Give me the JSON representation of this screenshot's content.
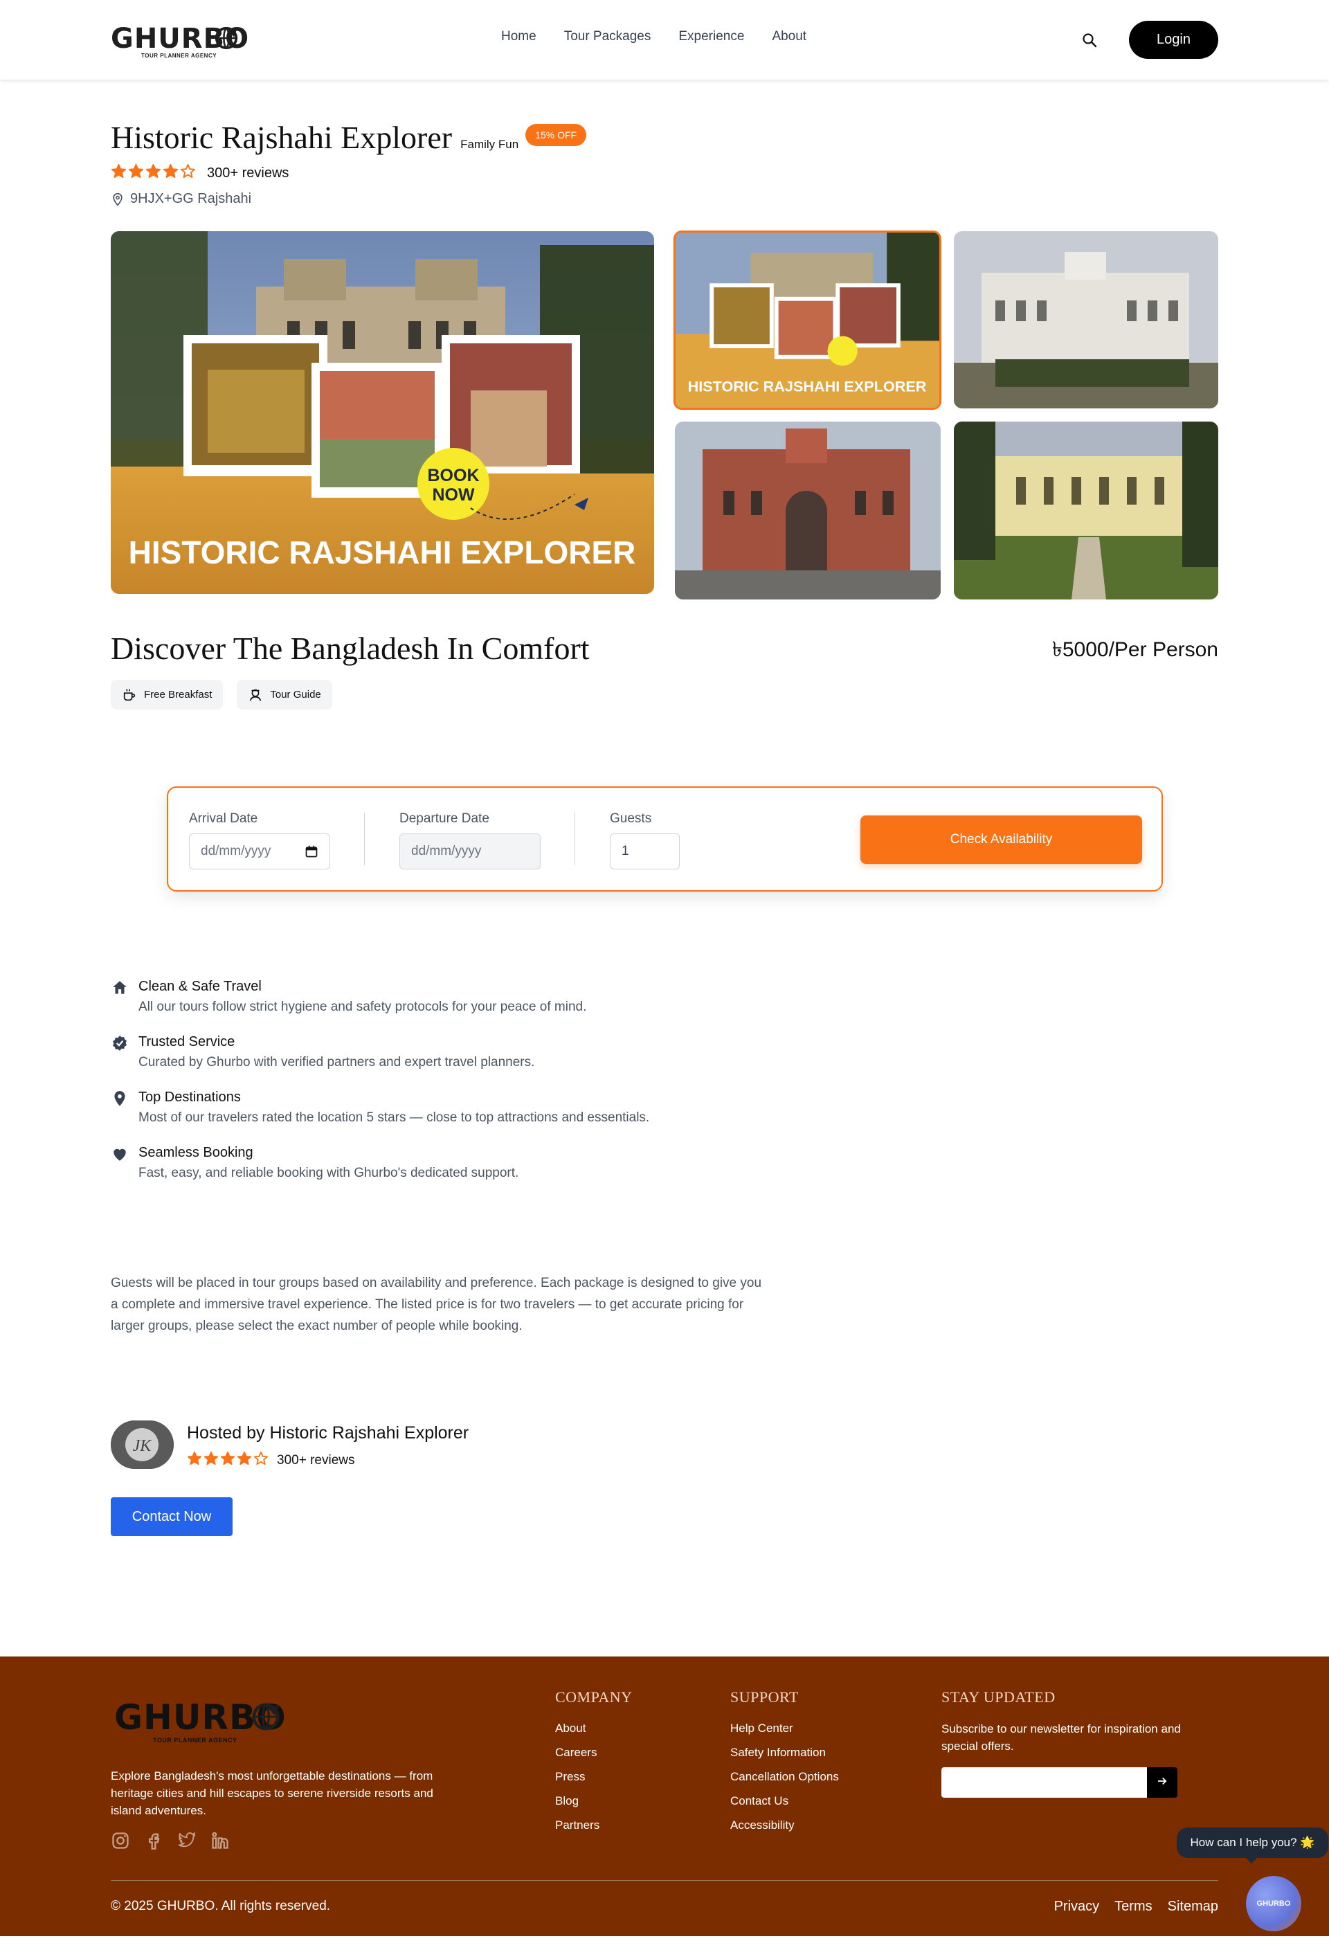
{
  "brand": {
    "name": "GHURBO",
    "tagline": "TOUR PLANNER AGENCY"
  },
  "nav": {
    "links": [
      "Home",
      "Tour Packages",
      "Experience",
      "About"
    ],
    "login_label": "Login"
  },
  "tour": {
    "title": "Historic Rajshahi Explorer",
    "category": "Family Fun",
    "discount": "15% OFF",
    "rating": 4,
    "rating_max": 5,
    "reviews": "300+ reviews",
    "location": "9HJX+GG Rajshahi",
    "poster_text": "HISTORIC RAJSHAHI EXPLORER",
    "poster_badge": [
      "BOOK",
      "NOW"
    ]
  },
  "discover": {
    "title": "Discover The Bangladesh In Comfort",
    "price": "৳5000/Per Person",
    "amenities": [
      "Free Breakfast",
      "Tour Guide"
    ]
  },
  "booking": {
    "arrival_label": "Arrival Date",
    "arrival_placeholder": "dd/mm/yyyy",
    "departure_label": "Departure Date",
    "departure_placeholder": "dd/mm/yyyy",
    "guests_label": "Guests",
    "guests_value": "1",
    "submit_label": "Check Availability"
  },
  "features": [
    {
      "icon": "home-icon",
      "title": "Clean & Safe Travel",
      "desc": "All our tours follow strict hygiene and safety protocols for your peace of mind."
    },
    {
      "icon": "verified-badge-icon",
      "title": "Trusted Service",
      "desc": "Curated by Ghurbo with verified partners and expert travel planners."
    },
    {
      "icon": "map-pin-icon",
      "title": "Top Destinations",
      "desc": "Most of our travelers rated the location 5 stars — close to top attractions and essentials."
    },
    {
      "icon": "heart-icon",
      "title": "Seamless Booking",
      "desc": "Fast, easy, and reliable booking with Ghurbo's dedicated support."
    }
  ],
  "description": "Guests will be placed in tour groups based on availability and preference. Each package is designed to give you a complete and immersive travel experience. The listed price is for two travelers — to get accurate pricing for larger groups, please select the exact number of people while booking.",
  "host": {
    "name": "Hosted by Historic Rajshahi Explorer",
    "rating": 4,
    "reviews": "300+ reviews",
    "contact_label": "Contact Now"
  },
  "footer": {
    "about": "Explore Bangladesh's most unforgettable destinations — from heritage cities and hill escapes to serene riverside resorts and island adventures.",
    "social": [
      "instagram-icon",
      "facebook-icon",
      "twitter-icon",
      "linkedin-icon"
    ],
    "company": {
      "title": "COMPANY",
      "links": [
        "About",
        "Careers",
        "Press",
        "Blog",
        "Partners"
      ]
    },
    "support": {
      "title": "SUPPORT",
      "links": [
        "Help Center",
        "Safety Information",
        "Cancellation Options",
        "Contact Us",
        "Accessibility"
      ]
    },
    "newsletter": {
      "title": "STAY UPDATED",
      "text": "Subscribe to our newsletter for inspiration and special offers."
    },
    "copyright": "© 2025 GHURBO. All rights reserved.",
    "bottom_links": [
      "Privacy",
      "Terms",
      "Sitemap"
    ]
  },
  "chat": {
    "prompt": "How can I help you? 🌟",
    "label": "GHURBO"
  },
  "colors": {
    "accent": "#f97316",
    "footer_bg": "#7b2d00",
    "primary_blue": "#2563eb",
    "star": "#f97316"
  }
}
